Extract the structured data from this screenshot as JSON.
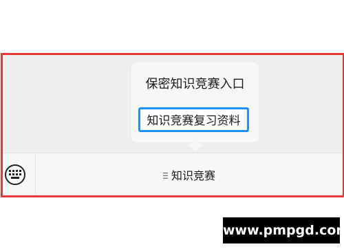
{
  "popup": {
    "items": [
      "保密知识竞赛入口",
      "知识竞赛复习资料"
    ]
  },
  "bottom_bar": {
    "keyboard_icon": "keyboard-icon",
    "menu_icon": "menu-lines-icon",
    "menu_label": "知识竞赛"
  },
  "watermark": {
    "text": "www.pmpgd.com"
  },
  "colors": {
    "highlight_border": "#e53935",
    "selection_border": "#1e90ff",
    "background": "#ededed",
    "bar": "#f7f7f7"
  }
}
